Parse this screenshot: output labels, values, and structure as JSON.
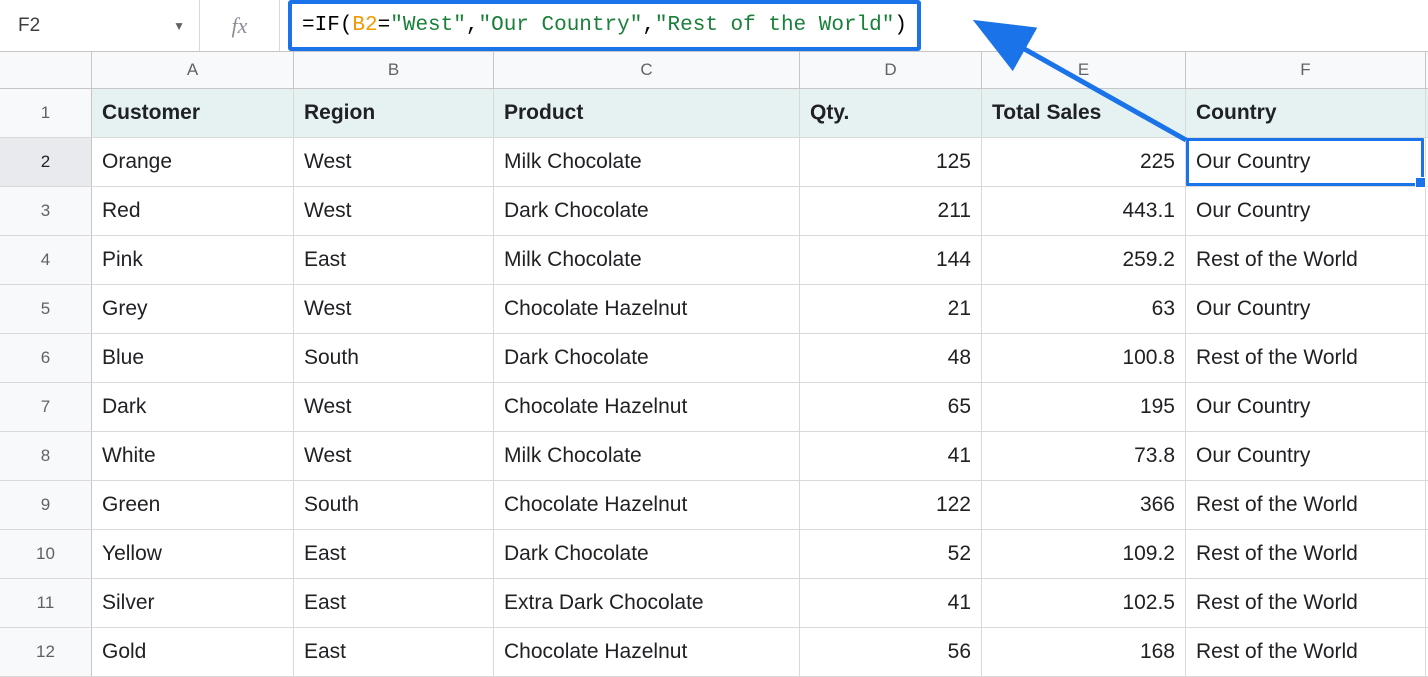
{
  "namebox": {
    "cell": "F2"
  },
  "formula": {
    "t1": "=IF",
    "t2": "(",
    "t3": "B2",
    "t4": "=",
    "t5": "\"West\"",
    "t6": ",",
    "t7": "\"Our Country\"",
    "t8": ",",
    "t9": "\"Rest of the World\"",
    "t10": ")"
  },
  "columns": {
    "A": "A",
    "B": "B",
    "C": "C",
    "D": "D",
    "E": "E",
    "F": "F"
  },
  "rownums": {
    "r1": "1",
    "r2": "2",
    "r3": "3",
    "r4": "4",
    "r5": "5",
    "r6": "6",
    "r7": "7",
    "r8": "8",
    "r9": "9",
    "r10": "10",
    "r11": "11",
    "r12": "12"
  },
  "headers": {
    "customer": "Customer",
    "region": "Region",
    "product": "Product",
    "qty": "Qty.",
    "total": "Total Sales",
    "country": "Country"
  },
  "rows": [
    {
      "customer": "Orange",
      "region": "West",
      "product": "Milk Chocolate",
      "qty": "125",
      "total": "225",
      "country": "Our Country"
    },
    {
      "customer": "Red",
      "region": "West",
      "product": "Dark Chocolate",
      "qty": "211",
      "total": "443.1",
      "country": "Our Country"
    },
    {
      "customer": "Pink",
      "region": "East",
      "product": "Milk Chocolate",
      "qty": "144",
      "total": "259.2",
      "country": "Rest of the World"
    },
    {
      "customer": "Grey",
      "region": "West",
      "product": "Chocolate Hazelnut",
      "qty": "21",
      "total": "63",
      "country": "Our Country"
    },
    {
      "customer": "Blue",
      "region": "South",
      "product": "Dark Chocolate",
      "qty": "48",
      "total": "100.8",
      "country": "Rest of the World"
    },
    {
      "customer": "Dark",
      "region": "West",
      "product": "Chocolate Hazelnut",
      "qty": "65",
      "total": "195",
      "country": "Our Country"
    },
    {
      "customer": "White",
      "region": "West",
      "product": "Milk Chocolate",
      "qty": "41",
      "total": "73.8",
      "country": "Our Country"
    },
    {
      "customer": "Green",
      "region": "South",
      "product": "Chocolate Hazelnut",
      "qty": "122",
      "total": "366",
      "country": "Rest of the World"
    },
    {
      "customer": "Yellow",
      "region": "East",
      "product": "Dark Chocolate",
      "qty": "52",
      "total": "109.2",
      "country": "Rest of the World"
    },
    {
      "customer": "Silver",
      "region": "East",
      "product": "Extra Dark Chocolate",
      "qty": "41",
      "total": "102.5",
      "country": "Rest of the World"
    },
    {
      "customer": "Gold",
      "region": "East",
      "product": "Chocolate Hazelnut",
      "qty": "56",
      "total": "168",
      "country": "Rest of the World"
    }
  ],
  "chart_data": {
    "type": "table",
    "columns": [
      "Customer",
      "Region",
      "Product",
      "Qty.",
      "Total Sales",
      "Country"
    ],
    "rows": [
      [
        "Orange",
        "West",
        "Milk Chocolate",
        125,
        225,
        "Our Country"
      ],
      [
        "Red",
        "West",
        "Dark Chocolate",
        211,
        443.1,
        "Our Country"
      ],
      [
        "Pink",
        "East",
        "Milk Chocolate",
        144,
        259.2,
        "Rest of the World"
      ],
      [
        "Grey",
        "West",
        "Chocolate Hazelnut",
        21,
        63,
        "Our Country"
      ],
      [
        "Blue",
        "South",
        "Dark Chocolate",
        48,
        100.8,
        "Rest of the World"
      ],
      [
        "Dark",
        "West",
        "Chocolate Hazelnut",
        65,
        195,
        "Our Country"
      ],
      [
        "White",
        "West",
        "Milk Chocolate",
        41,
        73.8,
        "Our Country"
      ],
      [
        "Green",
        "South",
        "Chocolate Hazelnut",
        122,
        366,
        "Rest of the World"
      ],
      [
        "Yellow",
        "East",
        "Dark Chocolate",
        52,
        109.2,
        "Rest of the World"
      ],
      [
        "Silver",
        "East",
        "Extra Dark Chocolate",
        41,
        102.5,
        "Rest of the World"
      ],
      [
        "Gold",
        "East",
        "Chocolate Hazelnut",
        56,
        168,
        "Rest of the World"
      ]
    ]
  }
}
